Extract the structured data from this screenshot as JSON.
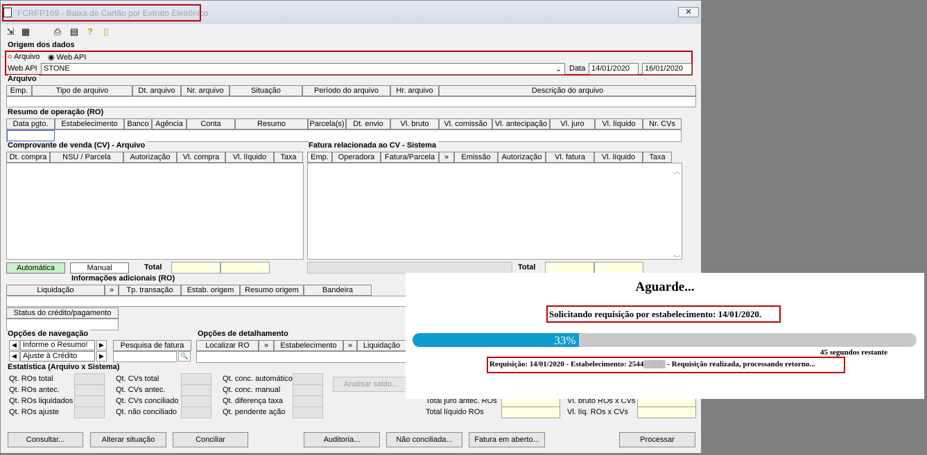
{
  "window": {
    "title": "FCRFP169 - Baixa de Cartão por Extrato Eletrônico",
    "close_label": "✕"
  },
  "origem": {
    "title": "Origem dos dados",
    "radio_arquivo": "Arquivo",
    "radio_webapi": "Web API",
    "webapi_label": "Web API",
    "webapi_value": "STONE",
    "data_label": "Data",
    "date_from": "14/01/2020",
    "date_to": "16/01/2020"
  },
  "arquivo": {
    "title": "Arquivo",
    "columns": [
      "Emp.",
      "Tipo de arquivo",
      "Dt. arquivo",
      "Nr. arquivo",
      "Situação",
      "Período do arquivo",
      "Hr. arquivo",
      "Descrição do arquivo"
    ]
  },
  "resumo": {
    "title": "Resumo de operação (RO)",
    "columns": [
      "Data pgto.",
      "Estabelecimento",
      "Banco",
      "Agência",
      "Conta",
      "Resumo",
      "Parcela(s)",
      "Dt. envio",
      "Vl. bruto",
      "Vl. comissão",
      "Vl. antecipação",
      "Vl. juro",
      "Vl. líquido",
      "Nr. CVs"
    ]
  },
  "cv": {
    "title": "Comprovante de venda (CV) - Arquivo",
    "columns": [
      "Dt. compra",
      "NSU / Parcela",
      "Autorização",
      "Vl. compra",
      "Vl. líquido",
      "Taxa"
    ],
    "automatica": "Automática",
    "manual": "Manual",
    "total": "Total"
  },
  "fatura": {
    "title": "Fatura relacionada ao CV - Sistema",
    "columns": [
      "Emp.",
      "Operadora",
      "Fatura/Parcela",
      "»",
      "Emissão",
      "Autorização",
      "Vl. fatura",
      "Vl. líquido",
      "Taxa"
    ],
    "total": "Total"
  },
  "info": {
    "title": "Informações adicionais (RO)",
    "columns": [
      "Liquidação",
      "»",
      "Tp. transação",
      "Estab. origem",
      "Resumo origem",
      "Bandeira"
    ],
    "status": "Status do crédito/pagamento"
  },
  "nav": {
    "title": "Opções de navegação",
    "opt1": "Informe o Resumo!",
    "opt2": "Ajuste à Crédito",
    "pesquisa": "Pesquisa de fatura"
  },
  "det": {
    "title": "Opções de detalhamento",
    "columns": [
      "Localizar RO",
      "»",
      "Estabelecimento",
      "»",
      "Liquidação"
    ]
  },
  "stats": {
    "title": "Estatística (Arquivo x Sistema)",
    "col1": [
      "Qt. ROs total",
      "Qt. ROs antec.",
      "Qt. ROs liquidados",
      "Qt. ROs ajuste"
    ],
    "col2": [
      "Qt. CVs total",
      "Qt. CVs antec.",
      "Qt. CVs conciliado",
      "Qt. não conciliado"
    ],
    "col3": [
      "Qt. conc. automático",
      "Qt. conc. manual",
      "Qt. diferença taxa",
      "Qt. pendente ação"
    ],
    "analisar": "Analisar saldo...",
    "right_labels": [
      "Total juro antec. ROs",
      "Total líquido ROs"
    ],
    "right_labels2": [
      "Vl. bruto ROs x CVs",
      "Vl. líq. ROs x CVs"
    ]
  },
  "buttons": {
    "consultar": "Consultar...",
    "alterar": "Alterar situação",
    "conciliar": "Conciliar",
    "auditoria": "Auditoria...",
    "nao_conciliada": "Não conciliada...",
    "fatura_aberto": "Fatura em aberto...",
    "processar": "Processar"
  },
  "modal": {
    "title": "Aguarde...",
    "status": "Solicitando requisição por estabelecimento: 14/01/2020.",
    "progress_label": "33%",
    "progress": 0.33,
    "remaining": "45 segundos restante",
    "detail": "Requisição: 14/01/2020 - Estabelecimento: 2544▒▒▒▒ - Requisição realizada, processando retorno..."
  }
}
